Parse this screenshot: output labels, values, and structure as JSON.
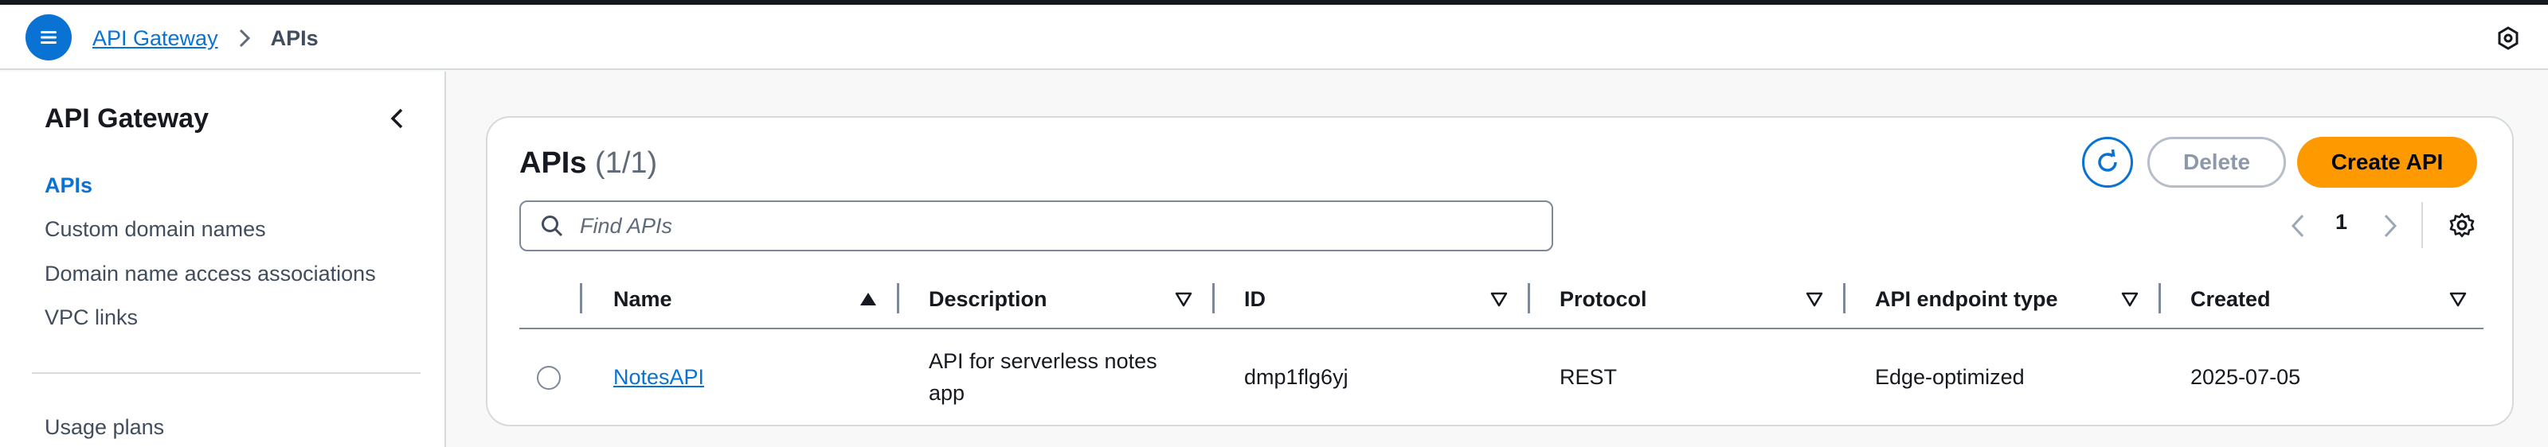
{
  "breadcrumb": {
    "root": "API Gateway",
    "current": "APIs"
  },
  "sidebar": {
    "title": "API Gateway",
    "items": [
      {
        "label": "APIs",
        "active": true
      },
      {
        "label": "Custom domain names"
      },
      {
        "label": "Domain name access associations"
      },
      {
        "label": "VPC links"
      },
      {
        "label": "Usage plans"
      }
    ]
  },
  "panel": {
    "title": "APIs",
    "count": "(1/1)",
    "delete_label": "Delete",
    "create_label": "Create API",
    "search_placeholder": "Find APIs",
    "page_number": "1"
  },
  "table": {
    "columns": [
      "Name",
      "Description",
      "ID",
      "Protocol",
      "API endpoint type",
      "Created"
    ],
    "rows": [
      {
        "name": "NotesAPI",
        "description": "API for serverless notes app",
        "id": "dmp1flg6yj",
        "protocol": "REST",
        "endpoint_type": "Edge-optimized",
        "created": "2025-07-05"
      }
    ]
  },
  "colors": {
    "accent": "#0972d3",
    "primary_button": "#ff9900"
  },
  "icons": [
    "menu-icon",
    "chevron-right-icon",
    "notifications-icon",
    "chevron-left-icon",
    "refresh-icon",
    "search-icon",
    "settings-icon",
    "sort-ascending-icon",
    "sort-descending-icon"
  ]
}
